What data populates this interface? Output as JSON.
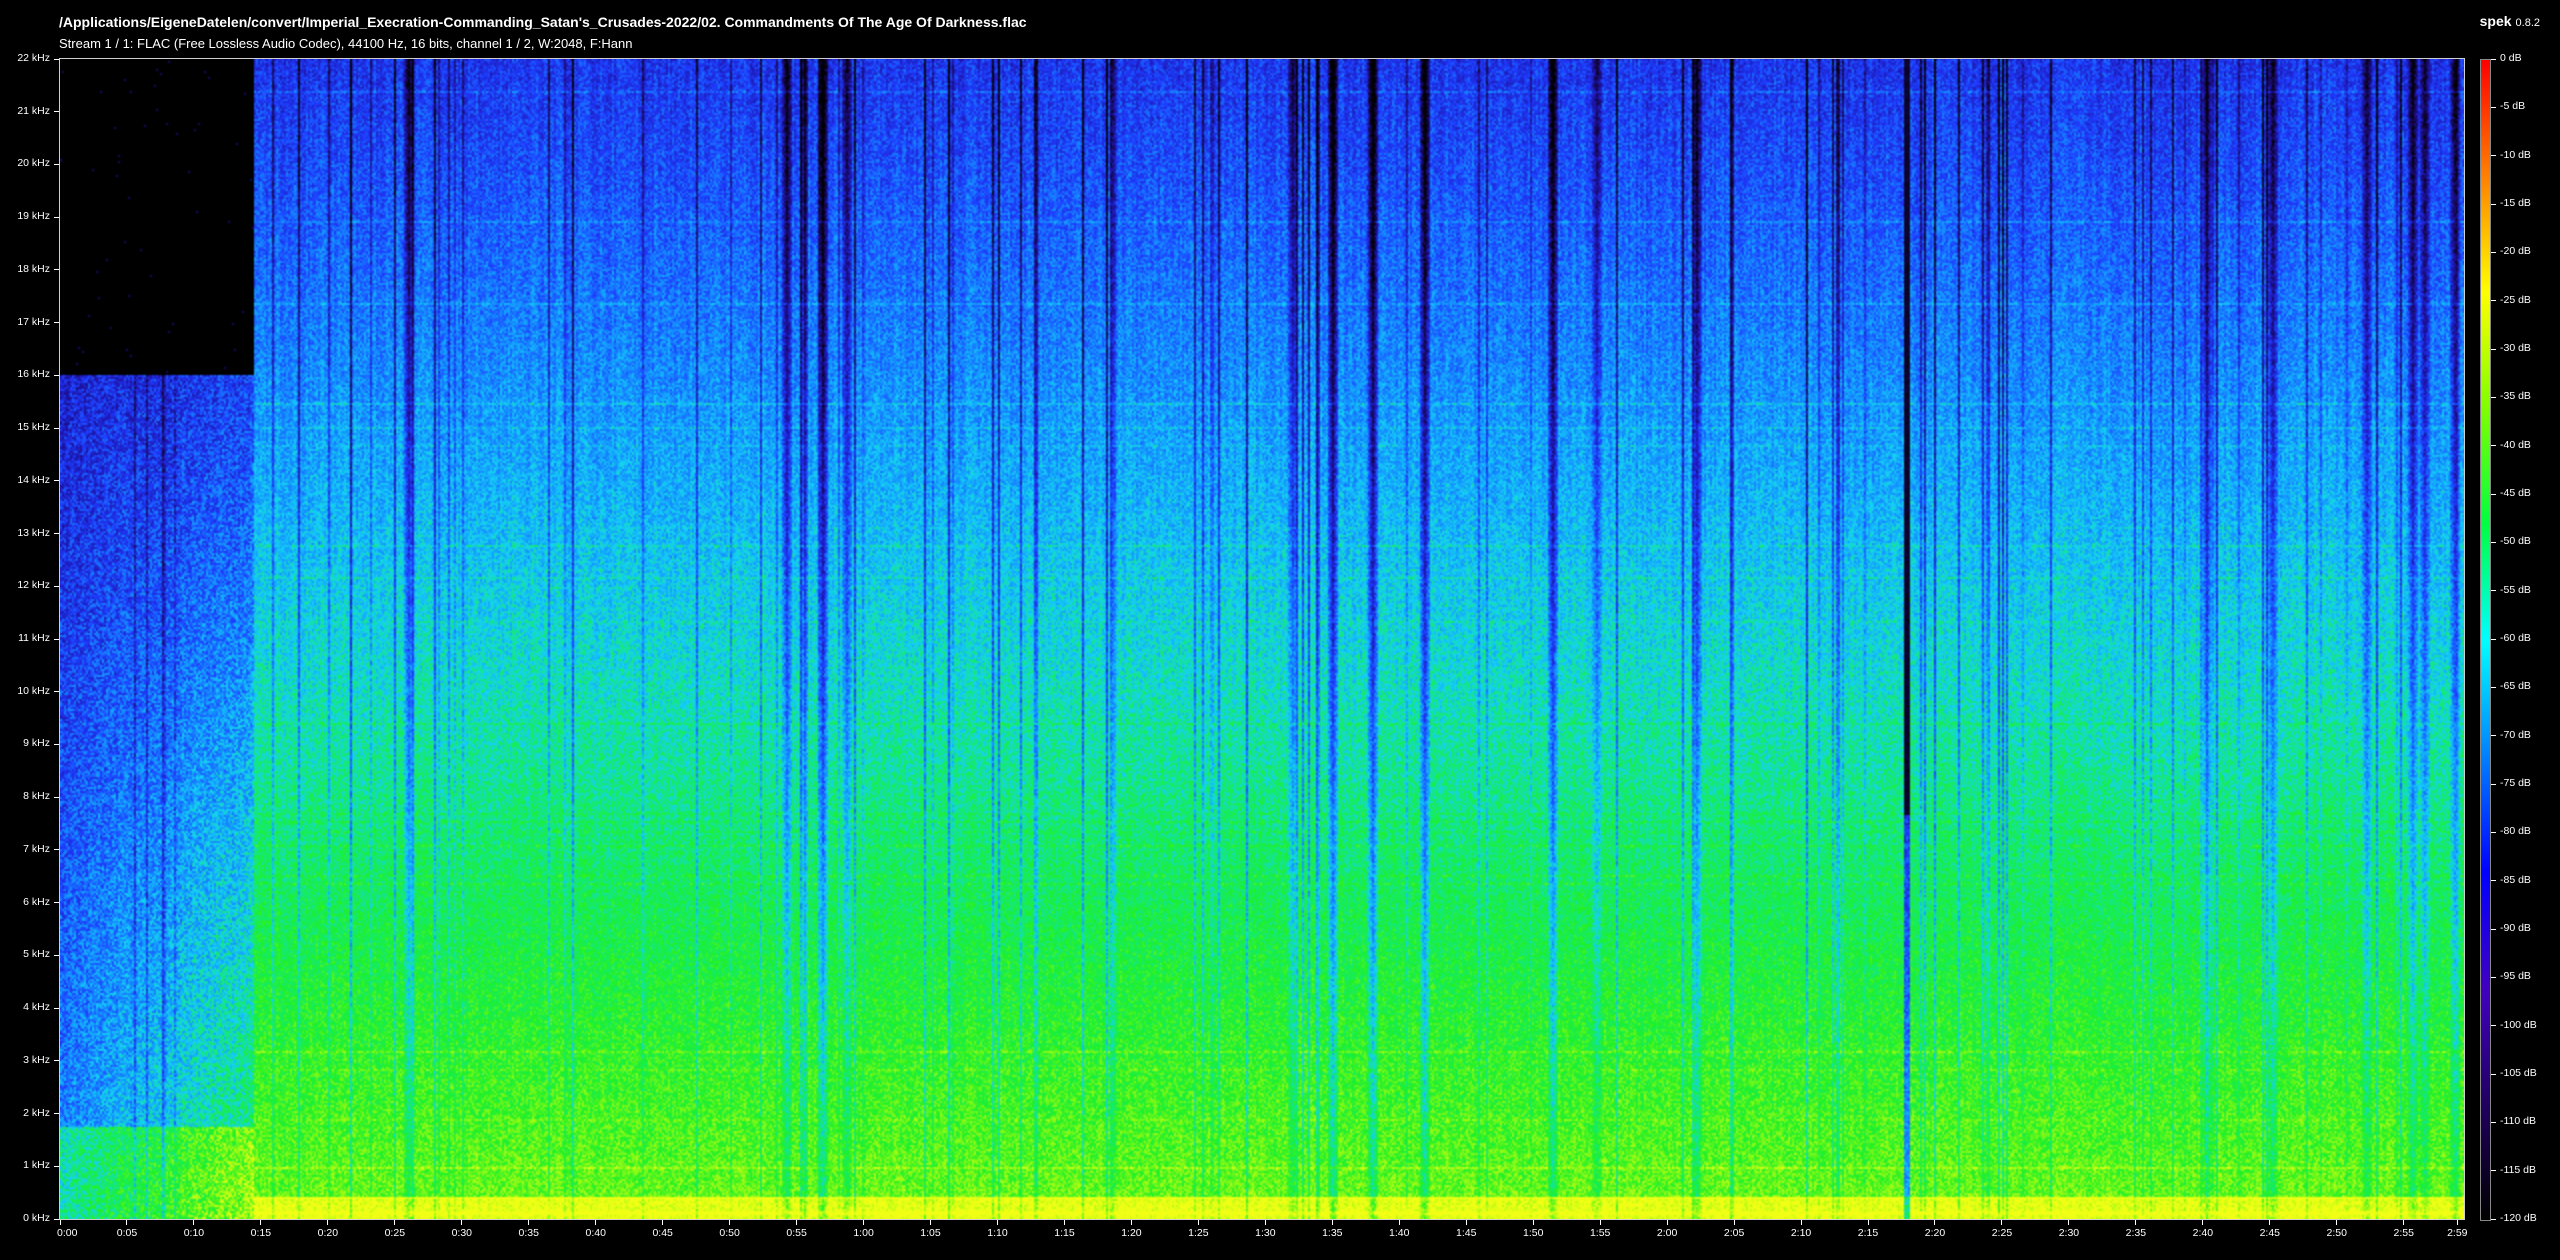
{
  "app": {
    "name": "spek",
    "version": "0.8.2"
  },
  "file_path": "/Applications/EigeneDatelen/convert/Imperial_Execration-Commanding_Satan's_Crusades-2022/02. Commandments Of The Age Of Darkness.flac",
  "stream_info": "Stream 1 / 1: FLAC (Free Lossless Audio Codec), 44100 Hz, 16 bits, channel 1 / 2, W:2048, F:Hann",
  "frequency_axis": {
    "labels": [
      "0 kHz",
      "1 kHz",
      "2 kHz",
      "3 kHz",
      "4 kHz",
      "5 kHz",
      "6 kHz",
      "7 kHz",
      "8 kHz",
      "9 kHz",
      "10 kHz",
      "11 kHz",
      "12 kHz",
      "13 kHz",
      "14 kHz",
      "15 kHz",
      "16 kHz",
      "17 kHz",
      "18 kHz",
      "19 kHz",
      "20 kHz",
      "21 kHz",
      "22 kHz"
    ],
    "max_khz": 22
  },
  "time_axis": {
    "labels": [
      "0:00",
      "0:05",
      "0:10",
      "0:15",
      "0:20",
      "0:25",
      "0:30",
      "0:35",
      "0:40",
      "0:45",
      "0:50",
      "0:55",
      "1:00",
      "1:05",
      "1:10",
      "1:15",
      "1:20",
      "1:25",
      "1:30",
      "1:35",
      "1:40",
      "1:45",
      "1:50",
      "1:55",
      "2:00",
      "2:05",
      "2:10",
      "2:15",
      "2:20",
      "2:25",
      "2:30",
      "2:35",
      "2:40",
      "2:45",
      "2:50",
      "2:55",
      "2:59"
    ],
    "duration_s": 179.5
  },
  "db_scale": {
    "labels": [
      "0 dB",
      "-5 dB",
      "-10 dB",
      "-15 dB",
      "-20 dB",
      "-25 dB",
      "-30 dB",
      "-35 dB",
      "-40 dB",
      "-45 dB",
      "-50 dB",
      "-55 dB",
      "-60 dB",
      "-65 dB",
      "-70 dB",
      "-75 dB",
      "-80 dB",
      "-85 dB",
      "-90 dB",
      "-95 dB",
      "-100 dB",
      "-105 dB",
      "-110 dB",
      "-115 dB",
      "-120 dB"
    ],
    "gradient_colors": [
      "#ff0000",
      "#ff8000",
      "#ffff00",
      "#80ff00",
      "#00ff40",
      "#00ffff",
      "#0080ff",
      "#0000ff",
      "#4000c0",
      "#200060",
      "#000000"
    ]
  },
  "spectrogram": {
    "colors": {
      "quiet": "#000000",
      "low": "#1a10a0",
      "blue": "#1e3cff",
      "cyan": "#17c8ff",
      "green": "#17ee2a",
      "yellow": "#e8ff10"
    },
    "intro_cutoff_khz": 16,
    "intro_end_s": 14.5,
    "dropout_s": 137.8
  }
}
